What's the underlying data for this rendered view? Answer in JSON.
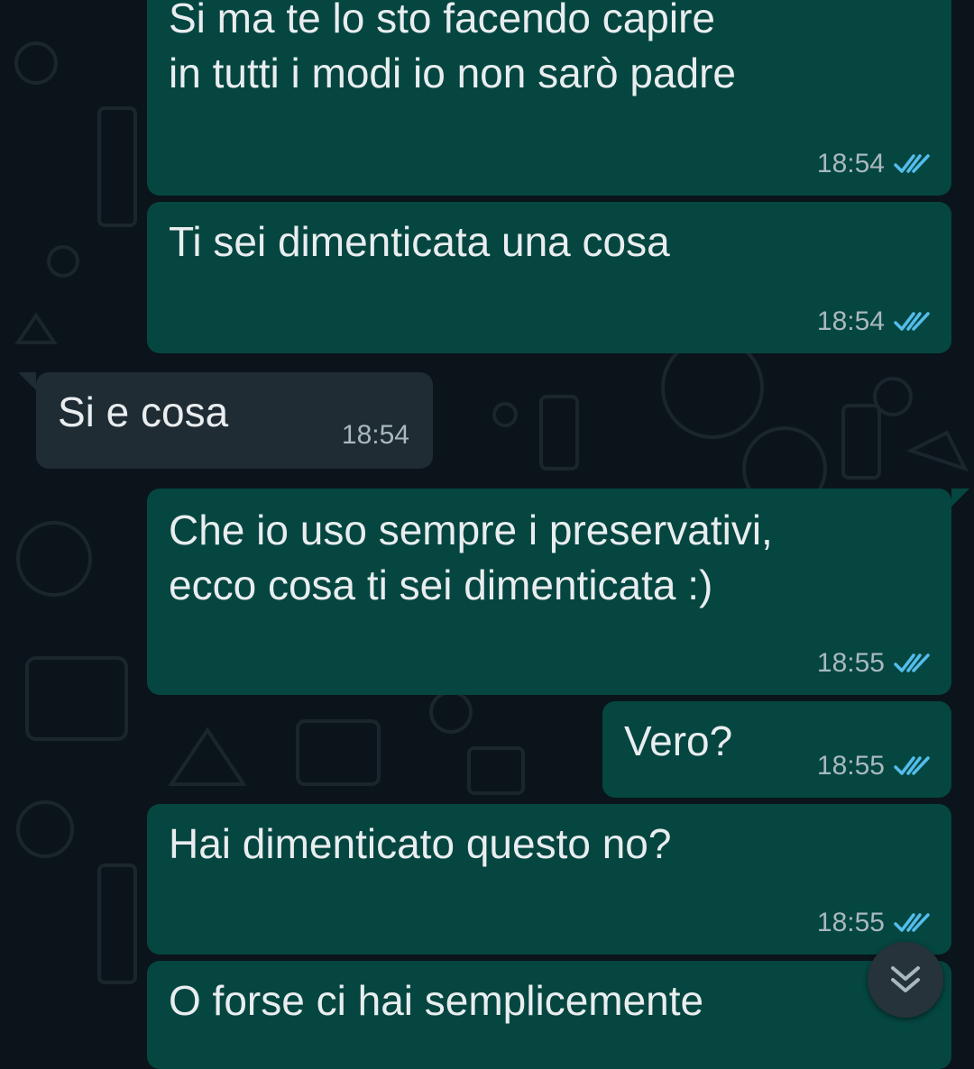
{
  "messages": [
    {
      "direction": "outgoing",
      "text": "Si ma te lo sto facendo capire\nin tutti i modi io non sarò padre",
      "time": "18:54",
      "status": "read"
    },
    {
      "direction": "outgoing",
      "text": "Ti sei dimenticata una cosa",
      "time": "18:54",
      "status": "read"
    },
    {
      "direction": "incoming",
      "text": "Si e cosa",
      "time": "18:54"
    },
    {
      "direction": "outgoing",
      "text": "Che io uso sempre i preservativi,\necco cosa ti sei dimenticata :)",
      "time": "18:55",
      "status": "read"
    },
    {
      "direction": "outgoing",
      "text": "Vero?",
      "time": "18:55",
      "status": "read"
    },
    {
      "direction": "outgoing",
      "text": "Hai dimenticato questo no?",
      "time": "18:55",
      "status": "read"
    },
    {
      "direction": "outgoing",
      "text": "O forse ci hai semplicemente"
    }
  ],
  "icons": {
    "read_receipt": "double-check-icon",
    "scroll_down": "chevron-double-down-icon"
  },
  "colors": {
    "background": "#0b141a",
    "outgoing_bubble": "#054640",
    "incoming_bubble": "#1f2c33",
    "text": "#e9edef",
    "meta_text": "#a9b8bf",
    "read_tick": "#53bdeb"
  }
}
